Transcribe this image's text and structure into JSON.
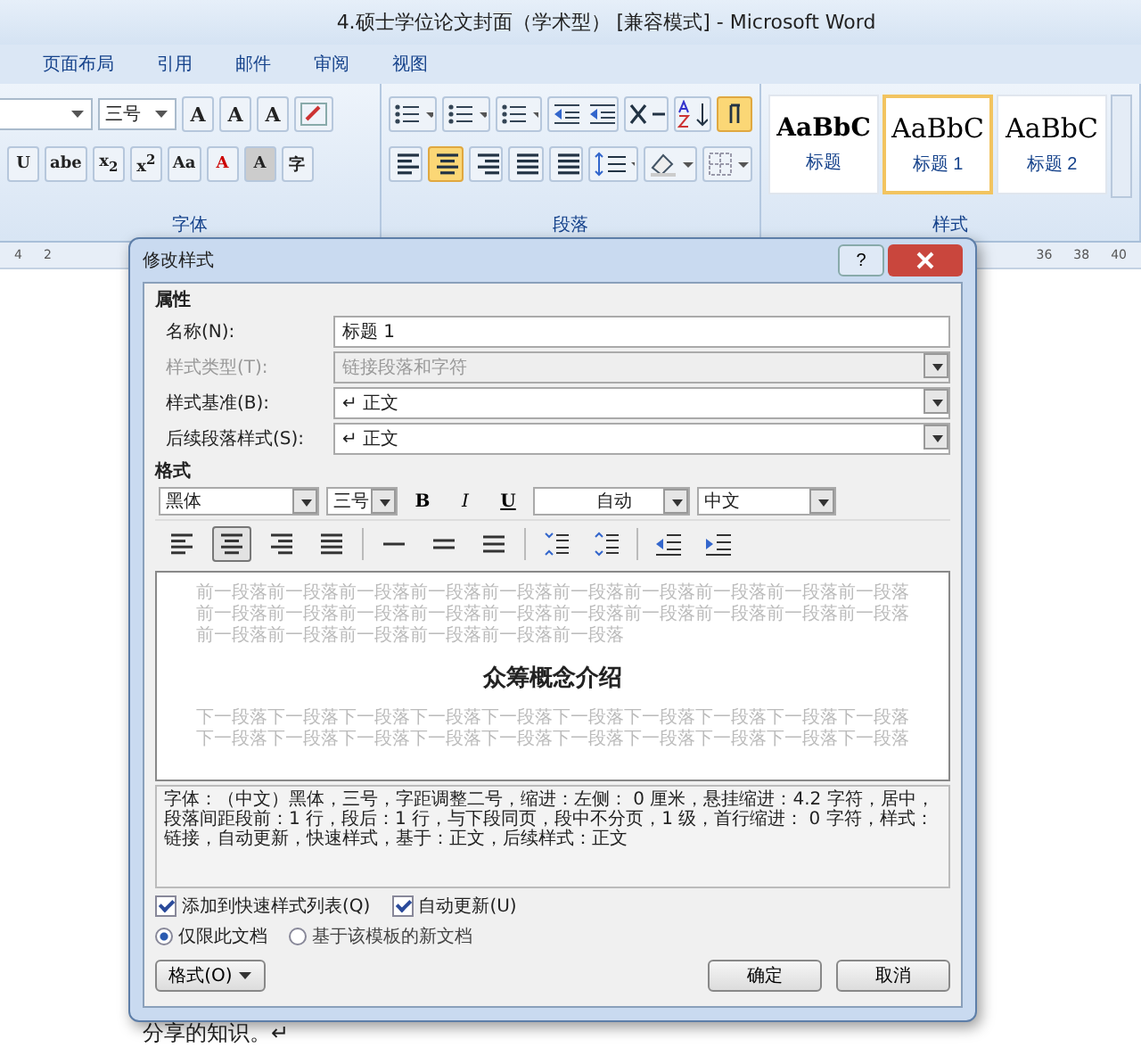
{
  "window": {
    "title": "4.硕士学位论文封面（学术型） [兼容模式] - Microsoft Word"
  },
  "tabs": [
    {
      "label": "页面布局",
      "selected": false
    },
    {
      "label": "引用",
      "selected": false
    },
    {
      "label": "邮件",
      "selected": false
    },
    {
      "label": "审阅",
      "selected": false
    },
    {
      "label": "视图",
      "selected": false
    }
  ],
  "ribbon": {
    "font_size": "三号",
    "font_row1": [
      "A",
      "A",
      "A"
    ],
    "font_row2": [
      "U",
      "abe",
      "x$_{2}$",
      "x$^{2}$",
      "Aa",
      "A",
      "A",
      "字"
    ],
    "paragraph_align": [
      {
        "kind": "left",
        "selected": false
      },
      {
        "kind": "center",
        "selected": true
      },
      {
        "kind": "right",
        "selected": false
      },
      {
        "kind": "justify",
        "selected": false
      },
      {
        "kind": "distributed",
        "selected": false
      }
    ],
    "groups": [
      {
        "label": "字体"
      },
      {
        "label": "段落"
      },
      {
        "label": "样式"
      }
    ],
    "styles": [
      {
        "preview": "AaBbC",
        "label": "标题",
        "selected": false
      },
      {
        "preview": "AaBbC",
        "label": "标题 1",
        "selected": true
      },
      {
        "preview": "AaBbC",
        "label": "标题 2",
        "selected": false
      }
    ]
  },
  "ruler": {
    "left_marks": [
      "4",
      "2"
    ],
    "right_marks": [
      "36",
      "38",
      "40"
    ]
  },
  "dialog": {
    "title": "修改样式",
    "help": "?",
    "properties_label": "属性",
    "fields": [
      {
        "label": "名称(N):",
        "value": "标题 1",
        "kind": "text",
        "disabled": false
      },
      {
        "label": "样式类型(T):",
        "value": "链接段落和字符",
        "kind": "dropdown",
        "disabled": true
      },
      {
        "label": "样式基准(B):",
        "value": "↵ 正文",
        "kind": "dropdown",
        "disabled": false
      },
      {
        "label": "后续段落样式(S):",
        "value": "↵ 正文",
        "kind": "dropdown",
        "disabled": false
      }
    ],
    "format_label": "格式",
    "font": "黑体",
    "size": "三号",
    "bold": "B",
    "italic": "I",
    "underline": "U",
    "font_color": "自动",
    "script": "中文",
    "align": [
      {
        "kind": "left",
        "selected": false
      },
      {
        "kind": "center",
        "selected": true
      },
      {
        "kind": "right",
        "selected": false
      },
      {
        "kind": "justify",
        "selected": false
      }
    ],
    "preview": {
      "previous": "前一段落前一段落前一段落前一段落前一段落前一段落前一段落前一段落前一段落前一段落前一段落前一段落前一段落前一段落前一段落前一段落前一段落前一段落前一段落前一段落前一段落前一段落前一段落前一段落前一段落前一段落",
      "heading": "众筹概念介绍",
      "next": "下一段落下一段落下一段落下一段落下一段落下一段落下一段落下一段落下一段落下一段落下一段落下一段落下一段落下一段落下一段落下一段落下一段落下一段落下一段落下一段落"
    },
    "description": "字体：（中文）黑体，三号，字距调整二号，缩进：左侧： 0 厘米，悬挂缩进：4.2 字符，居中，段落间距段前：1 行，段后：1 行，与下段同页，段中不分页，1 级，首行缩进： 0 字符，样式：链接，自动更新，快速样式，基于：正文，后续样式：正文",
    "checkboxes": [
      {
        "label": "添加到快速样式列表(Q)",
        "checked": true
      },
      {
        "label": "自动更新(U)",
        "checked": true
      }
    ],
    "radios": [
      {
        "label": "仅限此文档",
        "selected": true
      },
      {
        "label": "基于该模板的新文档",
        "selected": false
      }
    ],
    "format_button": "格式(O)",
    "ok": "确定",
    "cancel": "取消"
  },
  "document": {
    "text": "分享的知识。↵"
  }
}
